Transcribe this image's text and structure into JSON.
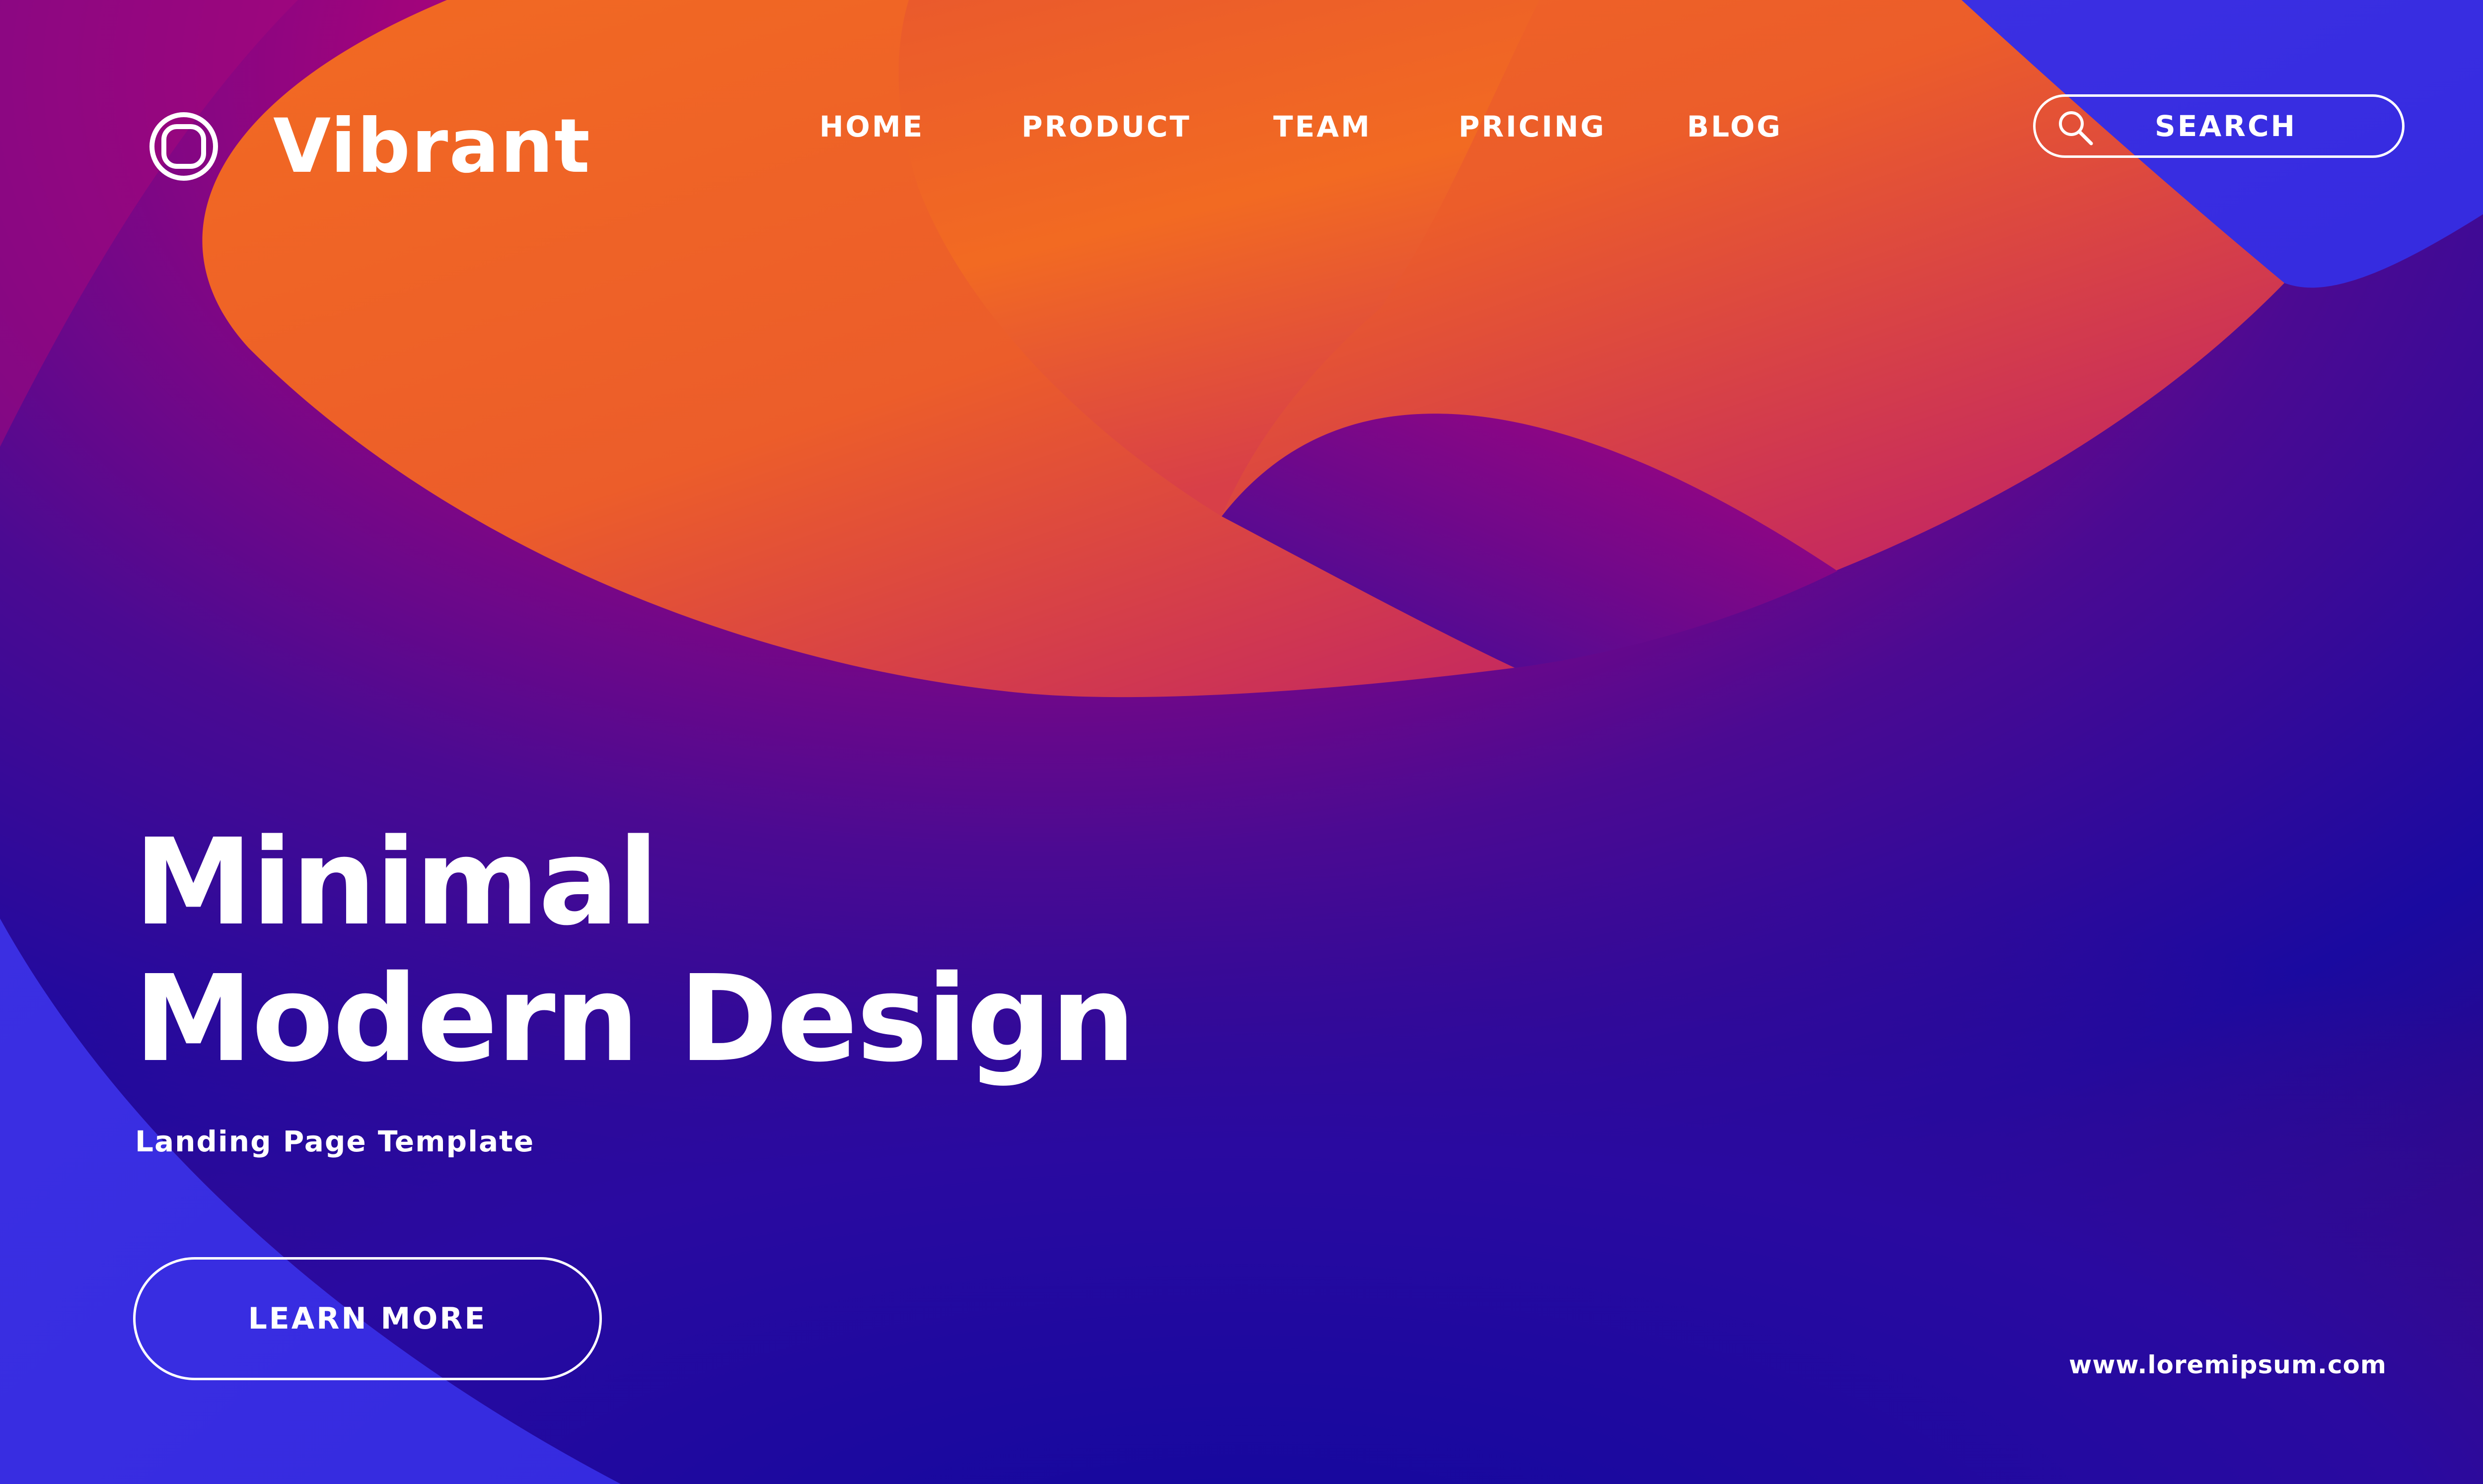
{
  "brand": {
    "name": "Vibrant",
    "logo_icon": "rounded-square-outline-icon"
  },
  "nav": {
    "items": [
      {
        "label": "HOME"
      },
      {
        "label": "PRODUCT"
      },
      {
        "label": "TEAM"
      },
      {
        "label": "PRICING"
      },
      {
        "label": "BLOG"
      }
    ]
  },
  "search": {
    "label": "SEARCH",
    "icon": "search-icon"
  },
  "hero": {
    "title_line1": "Minimal",
    "title_line2": "Modern Design",
    "subtitle": "Landing Page Template",
    "cta_label": "LEARN MORE"
  },
  "footer": {
    "website": "www.loremipsum.com"
  },
  "colors": {
    "text": "#ffffff",
    "deep_purple": "#3a0a8c",
    "royal_blue": "#3a2fe0",
    "magenta": "#b0007a",
    "orange": "#f26a22"
  }
}
